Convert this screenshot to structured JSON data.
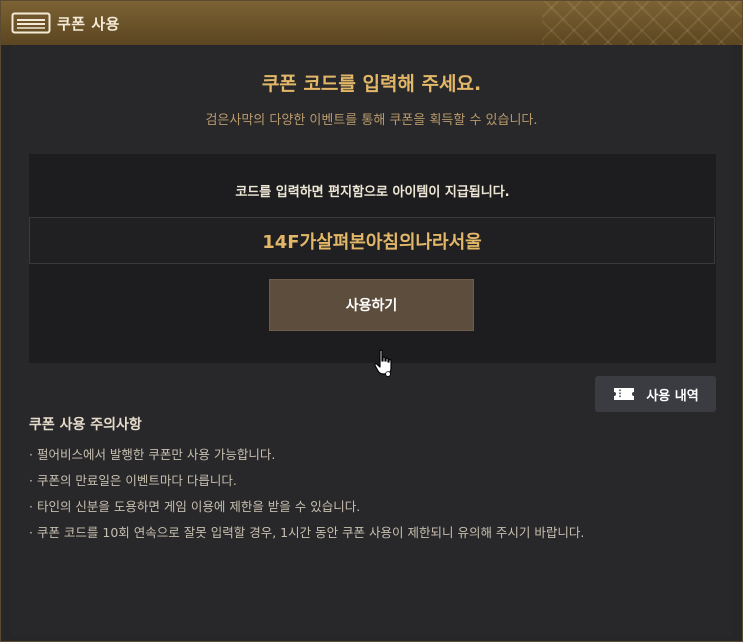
{
  "window": {
    "title": "쿠폰 사용",
    "accent_color": "#e3b768",
    "icons": {
      "title": "ticket-icon",
      "history": "ticket-icon",
      "cursor": "hand-pointer-icon"
    }
  },
  "main": {
    "heading": "쿠폰 코드를 입력해 주세요.",
    "subheading": "검은사막의 다양한 이벤트를 통해 쿠폰을 획득할 수 있습니다."
  },
  "redeem": {
    "note": "코드를 입력하면 편지함으로 아이템이 지급됩니다.",
    "code_value": "14F가살펴본아침의나라서울",
    "use_button_label": "사용하기"
  },
  "history": {
    "button_label": "사용 내역"
  },
  "notices": {
    "title": "쿠폰 사용 주의사항",
    "items": [
      "· 펄어비스에서 발행한 쿠폰만 사용 가능합니다.",
      "· 쿠폰의 만료일은 이벤트마다 다릅니다.",
      "· 타인의 신분을 도용하면 게임 이용에 제한을 받을 수 있습니다.",
      "· 쿠폰 코드를 10회 연속으로 잘못 입력할 경우, 1시간 동안 쿠폰 사용이 제한되니 유의해 주시기 바랍니다."
    ]
  }
}
